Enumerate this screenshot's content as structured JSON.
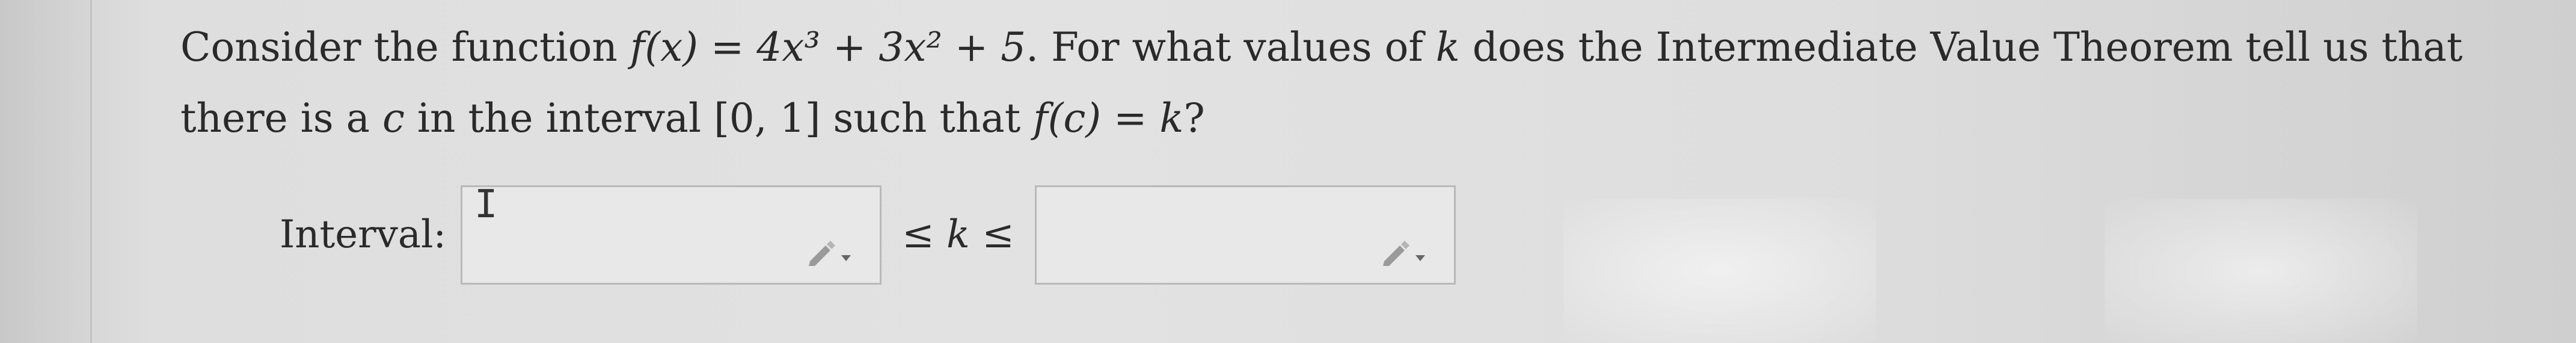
{
  "question": {
    "part1": "Consider the function ",
    "function_def": "f(x) = 4x³ + 3x² + 5",
    "part2": ". For what values of ",
    "variable_k": "k",
    "part3": " does the Intermediate Value Theorem tell us that there is a ",
    "variable_c": "c",
    "part4": " in the interval ",
    "interval": "[0, 1]",
    "part5": " such that ",
    "condition": "f(c) = k",
    "part6": "?"
  },
  "answer": {
    "label": "Interval:",
    "inequality": "≤ k ≤",
    "lower_value": "",
    "upper_value": "",
    "cursor_glyph": "I"
  },
  "icons": {
    "edit": "pencil-dropdown-icon"
  }
}
